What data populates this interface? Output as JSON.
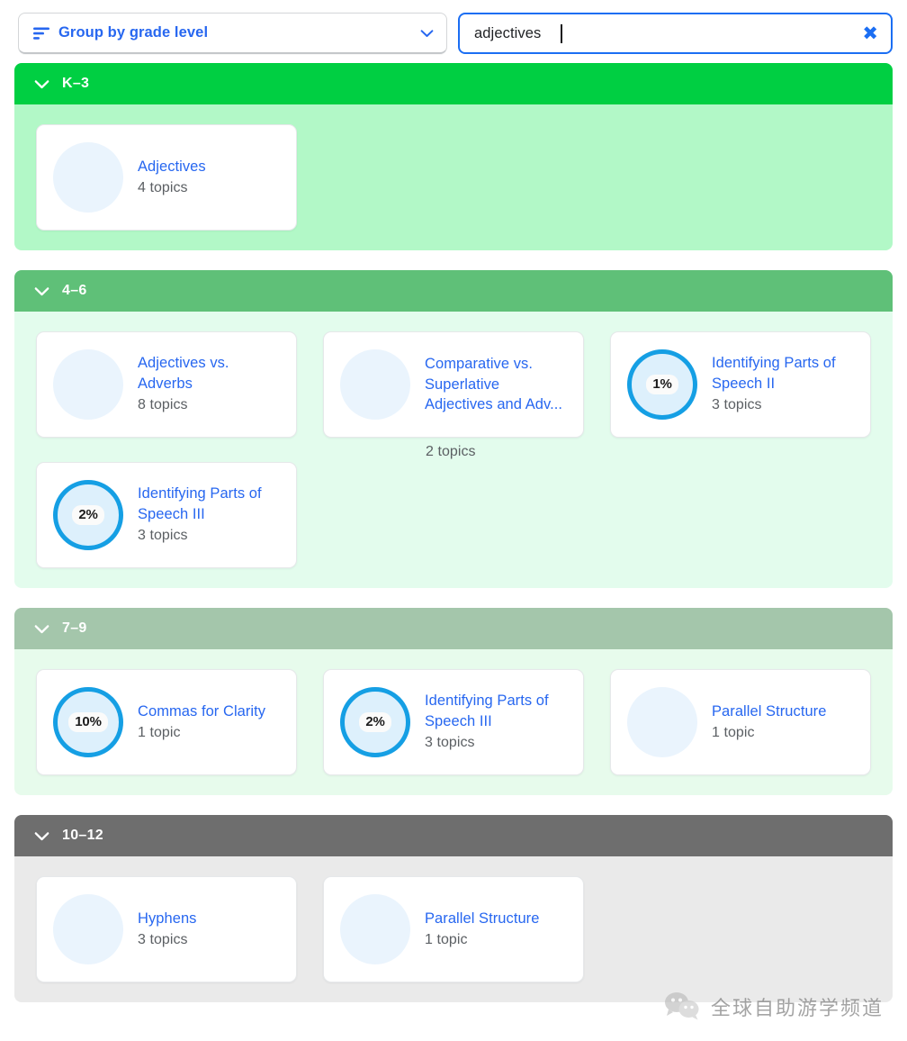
{
  "toolbar": {
    "group_by": {
      "label": "Group by grade level",
      "icon": "sort-lines-icon",
      "chevron": "chevron-down-icon",
      "accent": "#2767f0"
    },
    "search": {
      "value": "adjectives",
      "placeholder": "Search skills",
      "clear_label": "✖",
      "border_color": "#1b6ef3"
    }
  },
  "sections": [
    {
      "id": "k-3",
      "title": "K–3",
      "header_color": "#00cf42",
      "body_color": "#b2f8c7",
      "expanded": true,
      "cards": [
        {
          "title": "Adjectives",
          "sub": "4 topics",
          "progress": null
        }
      ]
    },
    {
      "id": "4-6",
      "title": "4–6",
      "header_color": "#5fc078",
      "body_color": "#e3fced",
      "expanded": true,
      "cards": [
        {
          "title": "Adjectives vs. Adverbs",
          "sub": "8 topics",
          "progress": null
        },
        {
          "title": "Comparative vs. Superlative Adjectives and Adv...",
          "sub": "2 topics",
          "progress": null,
          "overflow": true
        },
        {
          "title": "Identifying Parts of Speech II",
          "sub": "3 topics",
          "progress": "1%"
        },
        {
          "title": "Identifying Parts of Speech III",
          "sub": "3 topics",
          "progress": "2%"
        }
      ]
    },
    {
      "id": "7-9",
      "title": "7–9",
      "header_color": "#a4c6ab",
      "body_color": "#e7fbec",
      "expanded": true,
      "cards": [
        {
          "title": "Commas for Clarity",
          "sub": "1 topic",
          "progress": "10%"
        },
        {
          "title": "Identifying Parts of Speech III",
          "sub": "3 topics",
          "progress": "2%"
        },
        {
          "title": "Parallel Structure",
          "sub": "1 topic",
          "progress": null
        }
      ]
    },
    {
      "id": "10-12",
      "title": "10–12",
      "header_color": "#6e6e6e",
      "body_color": "#eaeaea",
      "expanded": true,
      "cards": [
        {
          "title": "Hyphens",
          "sub": "3 topics",
          "progress": null
        },
        {
          "title": "Parallel Structure",
          "sub": "1 topic",
          "progress": null
        }
      ]
    }
  ],
  "watermark": {
    "icon": "wechat-icon",
    "text": "全球自助游学频道"
  }
}
